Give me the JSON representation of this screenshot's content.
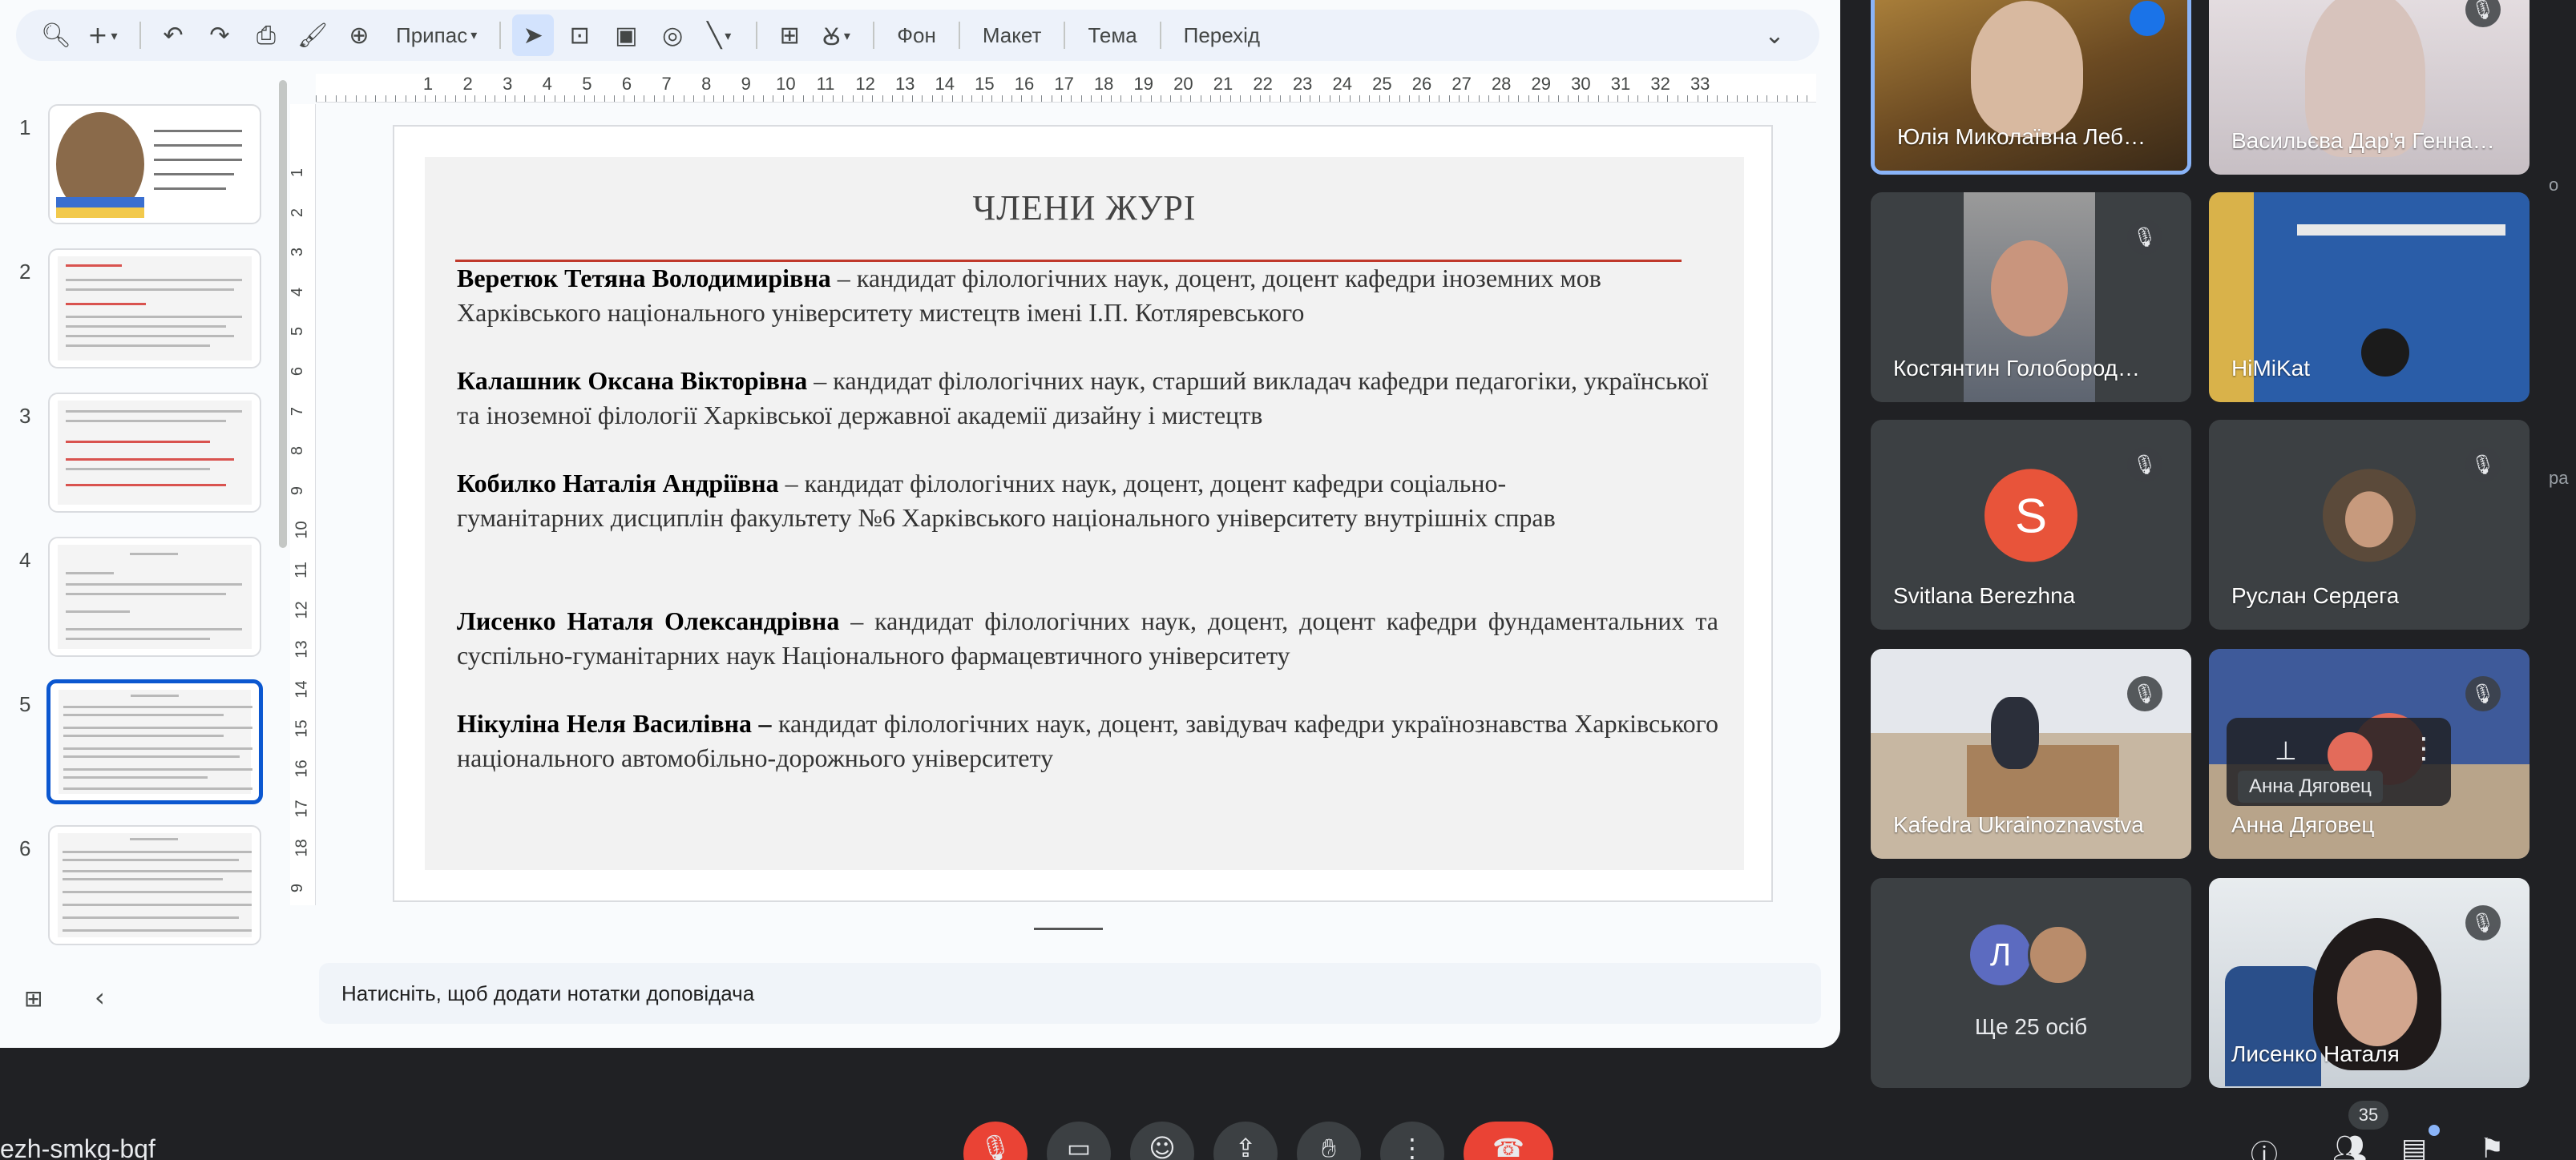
{
  "toolbar": {
    "zoom_label": "Припас",
    "items": [
      "Фон",
      "Макет",
      "Тема",
      "Перехід"
    ]
  },
  "filmstrip": {
    "numbers": [
      "1",
      "2",
      "3",
      "4",
      "5",
      "6"
    ],
    "selected": "5"
  },
  "ruler": {
    "h_numbers": [
      "1",
      "2",
      "3",
      "4",
      "5",
      "6",
      "7",
      "8",
      "9",
      "10",
      "11",
      "12",
      "13",
      "14",
      "15",
      "16",
      "17",
      "18",
      "19",
      "20",
      "21",
      "22",
      "23",
      "24",
      "25",
      "26",
      "27",
      "28",
      "29",
      "30",
      "31",
      "32",
      "33"
    ],
    "v_numbers": [
      "1",
      "2",
      "3",
      "4",
      "5",
      "6",
      "7",
      "8",
      "9",
      "10",
      "11",
      "12",
      "13",
      "14",
      "15",
      "16",
      "17",
      "18",
      "9"
    ]
  },
  "slide": {
    "title": "ЧЛЕНИ ЖУРІ",
    "members": [
      {
        "name": "Веретюк Тетяна Володимирівна",
        "desc": " – кандидат філологічних наук, доцент, доцент кафедри іноземних мов Харківського національного університету мистецтв імені І.П. Котляревського"
      },
      {
        "name": "Калашник Оксана Вікторівна",
        "desc": "  – кандидат філологічних наук, старший викладач кафедри педагогіки, української та іноземної філології Харківської державної академії дизайну і мистецтв"
      },
      {
        "name": "Кобилко Наталія Андріївна",
        "desc": " – кандидат філологічних наук, доцент, доцент кафедри соціально-гуманітарних дисциплін факультету №6 Харківського національного університету внутрішніх справ"
      },
      {
        "name": "Лисенко Наталя Олександрівна",
        "desc": " – кандидат філологічних наук, доцент, доцент кафедри фундаментальних та суспільно-гуманітарних наук Національного фармацевтичного університету"
      },
      {
        "name": "Нікуліна Неля Василівна –",
        "desc": " кандидат філологічних наук, доцент, завідувач кафедри українознавства Харківського національного автомобільно-дорожнього університету"
      }
    ]
  },
  "notes": {
    "placeholder": "Натисніть, щоб додати нотатки доповідача"
  },
  "participants": [
    {
      "name": "Юлія Миколаївна Леб…"
    },
    {
      "name": "Васильєва Дар'я Генна…"
    },
    {
      "name": "Костянтин Голобород…"
    },
    {
      "name": "HiMiKat"
    },
    {
      "name": "Svitlana Berezhna",
      "initial": "S"
    },
    {
      "name": "Руслан Сердега"
    },
    {
      "name": "Kafedra Ukrainoznavstva"
    },
    {
      "name": "Анна Дяговец",
      "hover_label": "Анна Дяговец"
    },
    {
      "more_label": "Ще 25 осіб",
      "initial": "Л"
    },
    {
      "name": "Лисенко Наталя"
    }
  ],
  "meeting": {
    "code": "ezh-smkg-bqf",
    "people_count": "35"
  },
  "colors": {
    "accent": "#0b57d0",
    "end_call": "#ea4335",
    "meet_bg": "#202124",
    "tile_bg": "#3c4043",
    "avatar_s": "#e8543a",
    "avatar_l": "#5c6bc0"
  },
  "edge_fragments": [
    "о",
    "ра"
  ]
}
